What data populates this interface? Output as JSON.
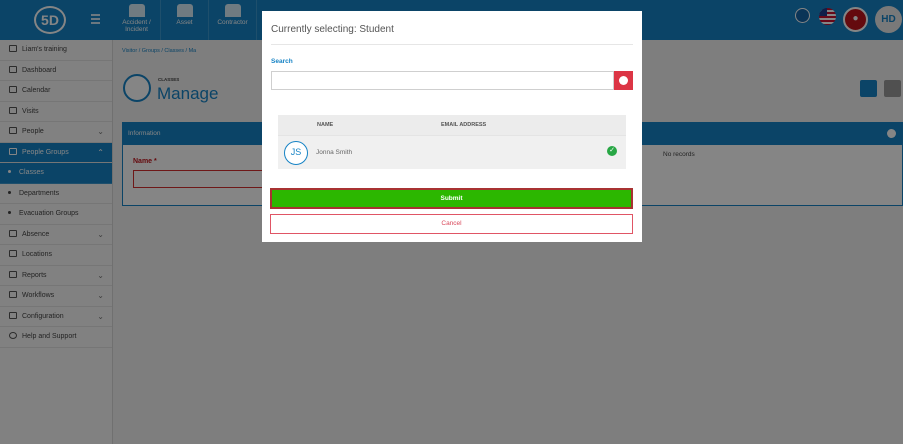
{
  "app": {
    "logo_text": "5D"
  },
  "topnav": [
    {
      "label": "Accident / Incident",
      "icon": "accident-icon"
    },
    {
      "label": "Asset",
      "icon": "asset-icon"
    },
    {
      "label": "Contractor",
      "icon": "contractor-icon"
    }
  ],
  "header": {
    "avatar_initials": "HD"
  },
  "sidebar": {
    "items": [
      {
        "label": "Liam's training",
        "icon": "org-icon"
      },
      {
        "label": "Dashboard",
        "icon": "dashboard-icon"
      },
      {
        "label": "Calendar",
        "icon": "calendar-icon"
      },
      {
        "label": "Visits",
        "icon": "visits-icon"
      },
      {
        "label": "People",
        "icon": "people-icon"
      },
      {
        "label": "People Groups",
        "icon": "people-groups-icon"
      },
      {
        "label": "Classes"
      },
      {
        "label": "Departments"
      },
      {
        "label": "Evacuation Groups"
      },
      {
        "label": "Absence",
        "icon": "absence-icon"
      },
      {
        "label": "Locations",
        "icon": "locations-icon"
      },
      {
        "label": "Reports",
        "icon": "reports-icon"
      },
      {
        "label": "Workflows",
        "icon": "workflows-icon"
      },
      {
        "label": "Configuration",
        "icon": "configuration-icon"
      },
      {
        "label": "Help and Support",
        "icon": "help-icon"
      }
    ]
  },
  "breadcrumb": [
    "Visitor",
    "Groups",
    "Classes",
    "Ma"
  ],
  "page": {
    "kicker": "CLASSES",
    "title": "Manage"
  },
  "panel": {
    "heading": "Information",
    "name_label": "Name",
    "required_mark": "*",
    "no_records": "No records"
  },
  "modal": {
    "title": "Currently selecting:",
    "selecting": "Student",
    "search_label": "Search",
    "search_value": "",
    "columns": [
      "NAME",
      "EMAIL ADDRESS"
    ],
    "rows": [
      {
        "initials": "JS",
        "name": "Jonna Smith",
        "email": "",
        "selected": true
      }
    ],
    "submit_label": "Submit",
    "cancel_label": "Cancel"
  },
  "colors": {
    "primary": "#1683c5",
    "submit": "#2cb700",
    "danger": "#dc3545"
  }
}
